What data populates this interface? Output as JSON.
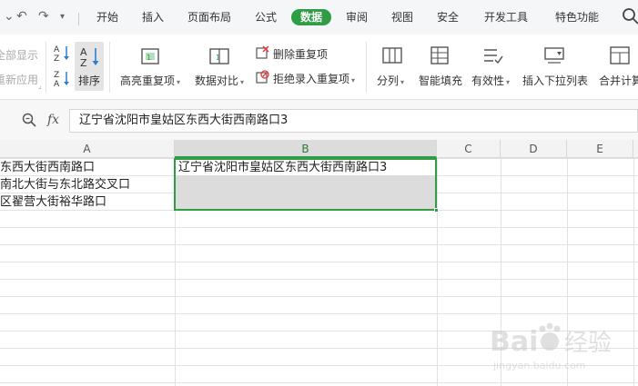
{
  "quick_access": {
    "undo_icon": "undo-icon",
    "redo_icon": "redo-icon",
    "dropdown_icon": "chevron-down-icon"
  },
  "tabs": [
    {
      "label": "开始"
    },
    {
      "label": "插入"
    },
    {
      "label": "页面布局"
    },
    {
      "label": "公式"
    },
    {
      "label": "数据",
      "active": true
    },
    {
      "label": "审阅"
    },
    {
      "label": "视图"
    },
    {
      "label": "安全"
    },
    {
      "label": "开发工具"
    },
    {
      "label": "特色功能"
    }
  ],
  "ribbon": {
    "show_all": "全部显示",
    "reapply": "重新应用",
    "sort": "排序",
    "highlight_dup": "高亮重复项",
    "data_compare": "数据对比",
    "remove_dup": "删除重复项",
    "reject_dup": "拒绝录入重复项",
    "split": "分列",
    "smart_fill": "智能填充",
    "validity": "有效性",
    "insert_dropdown": "插入下拉列表",
    "merge_calc": "合并计算"
  },
  "formula": {
    "fx": "fx",
    "value": "辽宁省沈阳市皇姑区东西大街西南路口3"
  },
  "columns": [
    "A",
    "B",
    "C",
    "D",
    "E"
  ],
  "cells": {
    "A1": "东西大街西南路口",
    "A2": "南北大街与东北路交叉口",
    "A3": "区翟营大街裕华路口",
    "B1": "辽宁省沈阳市皇姑区东西大街西南路口3"
  },
  "colors": {
    "accent": "#2e9d46",
    "annotation_arrow": "#e53935"
  }
}
